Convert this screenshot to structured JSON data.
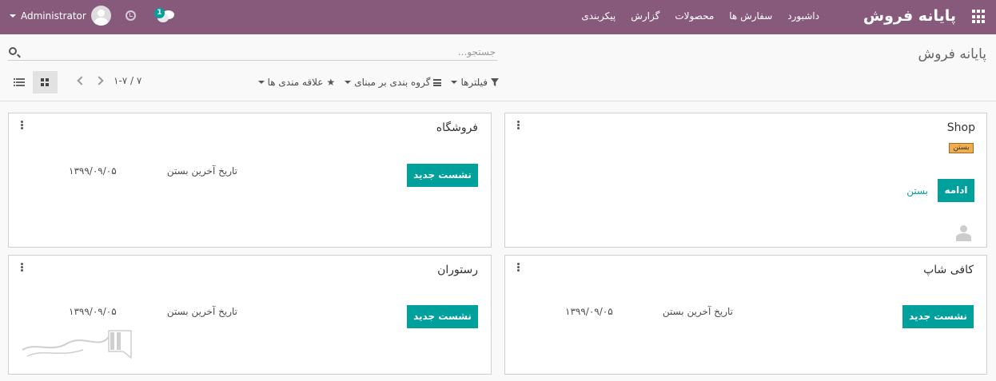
{
  "navbar": {
    "brand": "پایانه فروش",
    "menu": [
      "داشبورد",
      "سفارش ها",
      "محصولات",
      "گزارش",
      "پیکربندی"
    ],
    "user_name": "Administrator",
    "chat_count": "1",
    "icons": [
      "apps-icon",
      "clock-icon",
      "chat-icon",
      "avatar"
    ],
    "bg_color": "#875a7b"
  },
  "control_panel": {
    "breadcrumb": "پایانه فروش",
    "search_placeholder": "جستجو...",
    "filters_label": "فیلترها",
    "groupby_label": "گروه بندی بر مبنای",
    "favorites_label": "علاقه مندی ها",
    "pager": "۱-۷ / ۷"
  },
  "cards": [
    {
      "title": "Shop",
      "status_badge": "بستن",
      "primary_button": "ادامه",
      "secondary_link": "بستن"
    },
    {
      "title": "فروشگاه",
      "primary_button": "نشست جدید",
      "closing_label": "تاریخ آخرین بستن",
      "closing_date": "۱۳۹۹/۰۹/۰۵"
    },
    {
      "title": "کافی شاپ",
      "primary_button": "نشست جدید",
      "closing_label": "تاریخ آخرین بستن",
      "closing_date": "۱۳۹۹/۰۹/۰۵"
    },
    {
      "title": "رستوران",
      "primary_button": "نشست جدید",
      "closing_label": "تاریخ آخرین بستن",
      "closing_date": "۱۳۹۹/۰۹/۰۵"
    }
  ],
  "accent_color": "#00a09d"
}
